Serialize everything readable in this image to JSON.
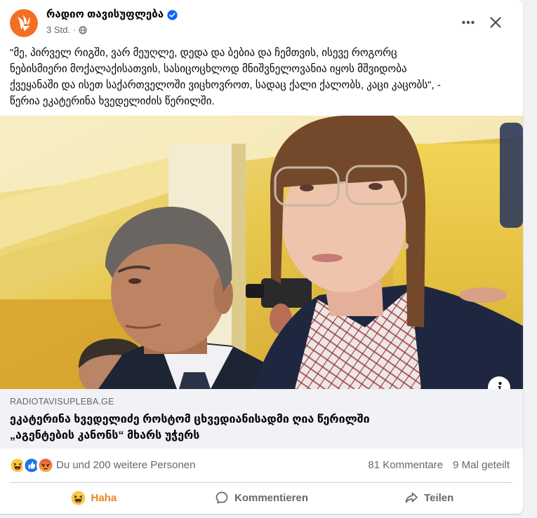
{
  "post": {
    "page_name": "რადიო თავისუფლება",
    "verified_icon": "verified-badge-icon",
    "time": "3 Std.",
    "time_separator": "·",
    "audience_icon": "globe-icon",
    "text_lines": [
      "\"მე, პირველ რიგში, ვარ მეუღლე, დედა და ბებია და ჩემთვის, ისევე როგორც",
      "ნებისმიერი მოქალაქისათვის, სასიცოცხლოდ მნიშვნელოვანია იყოს მშვიდობა",
      "ქვეყანაში და ისეთ საქართველოში ვიცხოვროთ, სადაც ქალი ქალობს, კაცი კაცობს\", -",
      "წერია ეკატერინა ხვედელიძის წერილში."
    ]
  },
  "header": {
    "more_icon": "more-icon",
    "close_icon": "close-icon"
  },
  "media": {
    "info_icon": "info-icon"
  },
  "link_preview": {
    "domain": "RADIOTAVISUPLEBA.GE",
    "title_lines": [
      "ეკატერინა ხვედელიძე როსტომ ცხვედიანისადმი ღია წერილში",
      "„აგენტების კანონს“ მხარს უჭერს"
    ]
  },
  "reactions": {
    "icons": [
      "haha-icon",
      "like-icon",
      "angry-icon"
    ],
    "summary": "Du und 200 weitere Personen",
    "comments": "81 Kommentare",
    "shares": "9 Mal geteilt"
  },
  "actions": [
    {
      "label": "Haha",
      "icon": "haha-icon",
      "active": true
    },
    {
      "label": "Kommentieren",
      "icon": "comment-icon",
      "active": false
    },
    {
      "label": "Teilen",
      "icon": "share-icon",
      "active": false
    }
  ],
  "colors": {
    "page_bg": "#f0f2f5",
    "text": "#050505",
    "muted": "#65676b",
    "accent": "#0866ff",
    "haha": "#e8851b",
    "avatar": "#f36f21",
    "preview_bg": "#f0f2f5"
  }
}
